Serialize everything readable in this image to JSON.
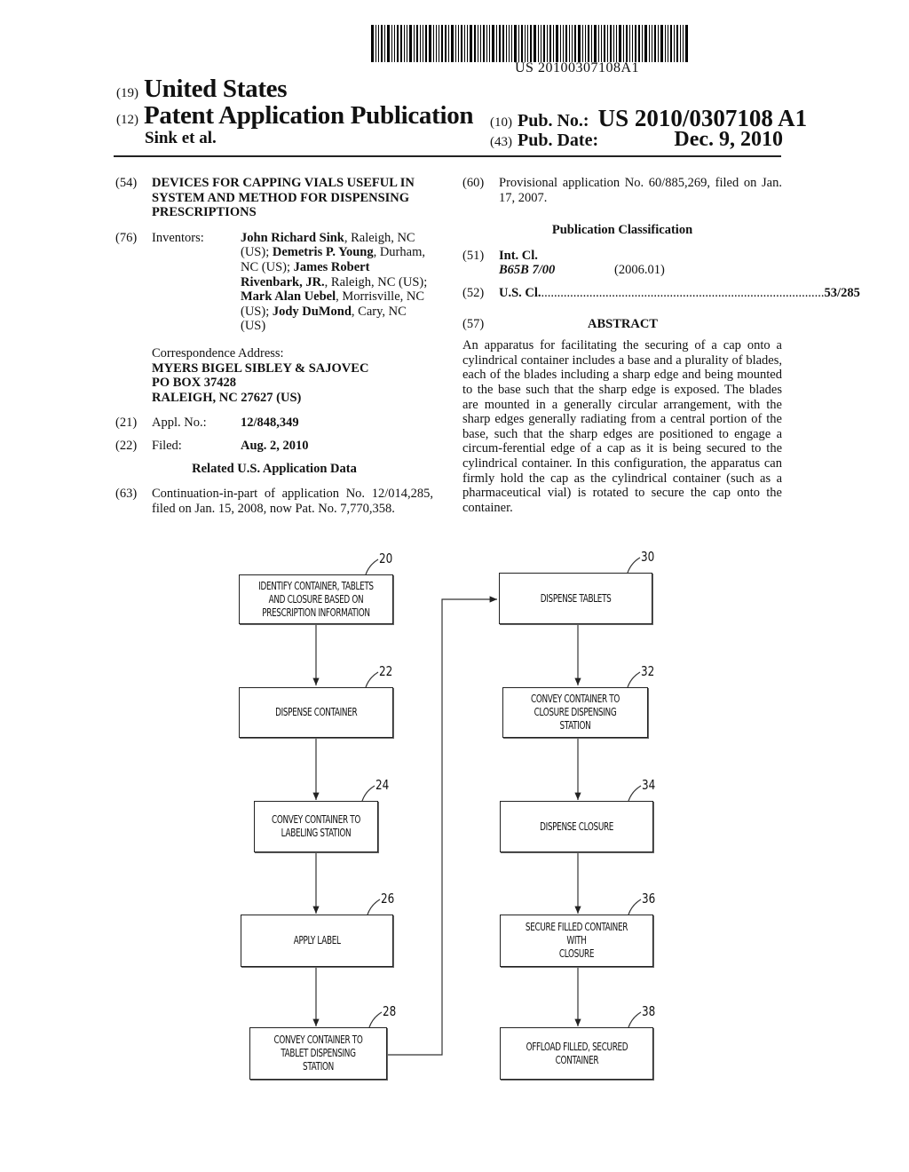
{
  "header": {
    "barcode_text": "US 20100307108A1",
    "country_code": "(19)",
    "country": "United States",
    "type_code": "(12)",
    "publication_type": "Patent Application Publication",
    "authors": "Sink et al.",
    "pub_no_code": "(10)",
    "pub_no_label": "Pub. No.:",
    "pub_no": "US 2010/0307108 A1",
    "pub_date_code": "(43)",
    "pub_date_label": "Pub. Date:",
    "pub_date": "Dec. 9, 2010"
  },
  "left": {
    "title_code": "(54)",
    "title": "DEVICES FOR CAPPING VIALS USEFUL IN SYSTEM AND METHOD FOR DISPENSING PRESCRIPTIONS",
    "inventors_code": "(76)",
    "inventors_label": "Inventors:",
    "inventors": [
      {
        "name": "John Richard Sink",
        "loc": ", Raleigh, NC (US); "
      },
      {
        "name": "Demetris P. Young",
        "loc": ", Durham, NC (US); "
      },
      {
        "name": "James Robert Rivenbark, JR.",
        "loc": ", Raleigh, NC (US); "
      },
      {
        "name": "Mark Alan Uebel",
        "loc": ", Morrisville, NC (US); "
      },
      {
        "name": "Jody DuMond",
        "loc": ", Cary, NC (US)"
      }
    ],
    "correspondence_label": "Correspondence Address:",
    "correspondence_lines": [
      "MYERS BIGEL SIBLEY & SAJOVEC",
      "PO BOX 37428",
      "RALEIGH, NC 27627 (US)"
    ],
    "appl_code": "(21)",
    "appl_label": "Appl. No.:",
    "appl_no": "12/848,349",
    "filed_code": "(22)",
    "filed_label": "Filed:",
    "filed": "Aug. 2, 2010",
    "related_heading": "Related U.S. Application Data",
    "continuation_code": "(63)",
    "continuation": "Continuation-in-part of application No. 12/014,285, filed on Jan. 15, 2008, now Pat. No. 7,770,358."
  },
  "right": {
    "provisional_code": "(60)",
    "provisional": "Provisional application No. 60/885,269, filed on Jan. 17, 2007.",
    "classification_heading": "Publication Classification",
    "int_cl_code": "(51)",
    "int_cl_label": "Int. Cl.",
    "int_cl_value": "B65B 7/00",
    "int_cl_year": "(2006.01)",
    "us_cl_code": "(52)",
    "us_cl_label": "U.S. Cl.",
    "us_cl_dots": "..............................................................................................",
    "us_cl_value": "53/285",
    "abstract_code": "(57)",
    "abstract_heading": "ABSTRACT",
    "abstract": "An apparatus for facilitating the securing of a cap onto a cylindrical container includes a base and a plurality of blades, each of the blades including a sharp edge and being mounted to the base such that the sharp edge is exposed. The blades are mounted in a generally circular arrangement, with the sharp edges generally radiating from a central portion of the base, such that the sharp edges are positioned to engage a circum-ferential edge of a cap as it is being secured to the cylindrical container. In this configuration, the apparatus can firmly hold the cap as the cylindrical container (such as a pharmaceutical vial) is rotated to secure the cap onto the container."
  },
  "flowchart": {
    "steps": [
      {
        "ref": "20",
        "text": "IDENTIFY CONTAINER, TABLETS\nAND CLOSURE BASED ON\nPRESCRIPTION INFORMATION"
      },
      {
        "ref": "22",
        "text": "DISPENSE CONTAINER"
      },
      {
        "ref": "24",
        "text": "CONVEY CONTAINER TO\nLABELING STATION"
      },
      {
        "ref": "26",
        "text": "APPLY LABEL"
      },
      {
        "ref": "28",
        "text": "CONVEY CONTAINER TO\nTABLET DISPENSING STATION"
      },
      {
        "ref": "30",
        "text": "DISPENSE TABLETS"
      },
      {
        "ref": "32",
        "text": "CONVEY CONTAINER TO\nCLOSURE DISPENSING STATION"
      },
      {
        "ref": "34",
        "text": "DISPENSE CLOSURE"
      },
      {
        "ref": "36",
        "text": "SECURE FILLED CONTAINER WITH\nCLOSURE"
      },
      {
        "ref": "38",
        "text": "OFFLOAD FILLED, SECURED\nCONTAINER"
      }
    ]
  }
}
